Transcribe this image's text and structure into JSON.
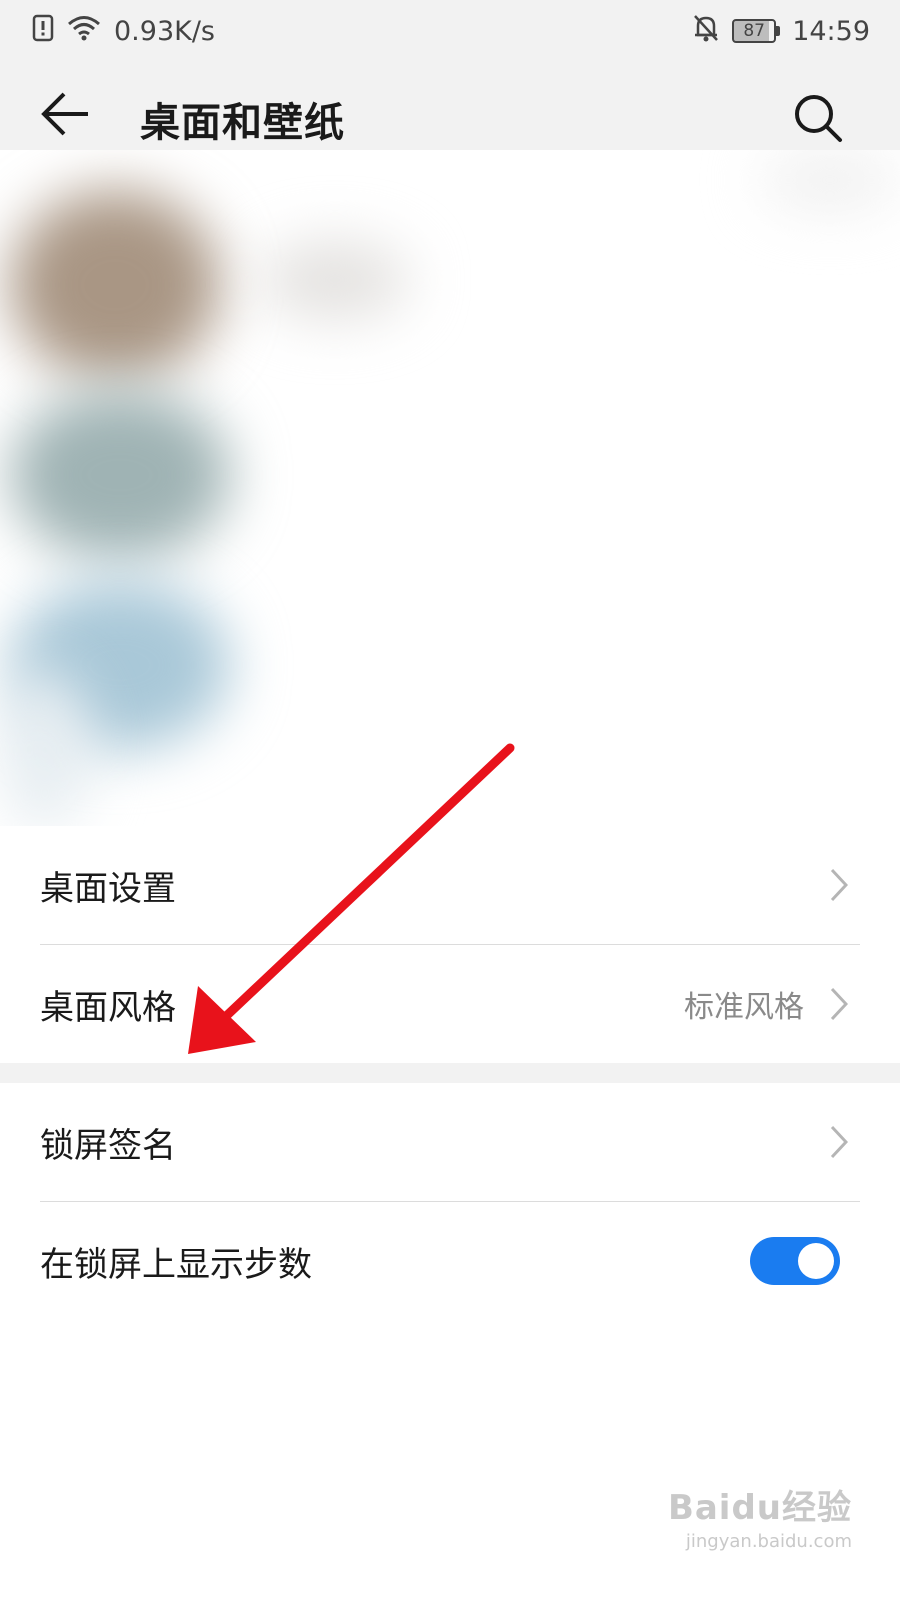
{
  "status_bar": {
    "network_speed": "0.93K/s",
    "battery_level": "87",
    "time": "14:59",
    "icons": [
      "sim-alert-icon",
      "wifi-icon",
      "notification-off-icon",
      "battery-icon"
    ]
  },
  "header": {
    "title": "桌面和壁纸",
    "back_icon": "back-arrow-icon",
    "search_icon": "search-icon"
  },
  "settings": {
    "group1": [
      {
        "label": "桌面设置",
        "value": ""
      },
      {
        "label": "桌面风格",
        "value": "标准风格"
      }
    ],
    "group2": [
      {
        "label": "锁屏签名"
      },
      {
        "label": "在锁屏上显示步数",
        "toggle_on": true
      }
    ]
  },
  "colors": {
    "accent": "#1a7cf0",
    "annotation_arrow": "#e8121b",
    "header_bg": "#f2f2f2"
  },
  "watermark": {
    "logo": "Baidu经验",
    "url": "jingyan.baidu.com"
  }
}
